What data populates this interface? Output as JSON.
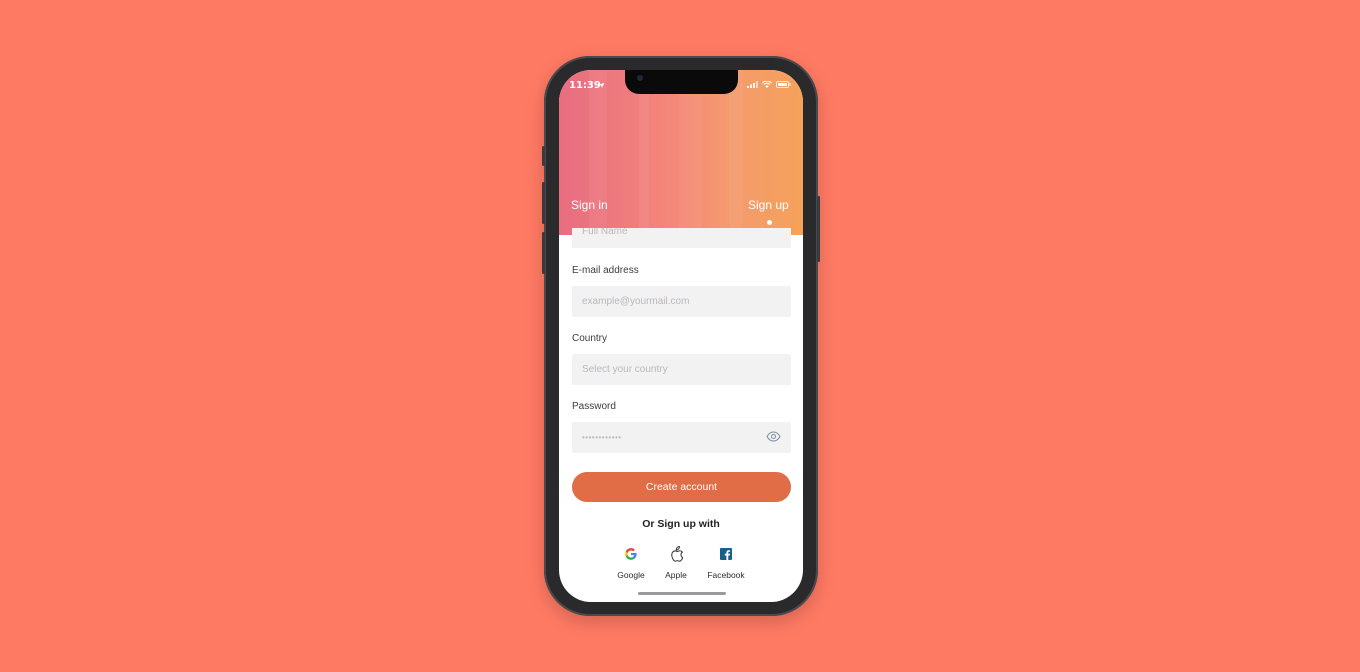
{
  "status_bar": {
    "time": "11:39",
    "location_icon": "location-arrow-icon",
    "signal_icon": "cellular-signal-icon",
    "wifi_icon": "wifi-icon",
    "battery_icon": "battery-icon"
  },
  "tabs": {
    "sign_in": "Sign in",
    "sign_up": "Sign up",
    "active": "Sign up"
  },
  "form": {
    "full_name": {
      "placeholder": "Full Name"
    },
    "email": {
      "label": "E-mail address",
      "placeholder": "example@yourmail.com"
    },
    "country": {
      "label": "Country",
      "placeholder": "Select your country"
    },
    "password": {
      "label": "Password",
      "value": "••••••••••••",
      "toggle_icon": "eye-icon"
    },
    "submit_label": "Create account"
  },
  "social": {
    "heading": "Or Sign up with",
    "providers": [
      {
        "label": "Google",
        "icon": "google-icon"
      },
      {
        "label": "Apple",
        "icon": "apple-icon"
      },
      {
        "label": "Facebook",
        "icon": "facebook-icon"
      }
    ]
  },
  "colors": {
    "background": "#FF7A63",
    "accent": "#E16D47",
    "header_gradient_start": "#E86D80",
    "header_gradient_end": "#F5A25A",
    "input_bg": "#F3F2F3"
  }
}
